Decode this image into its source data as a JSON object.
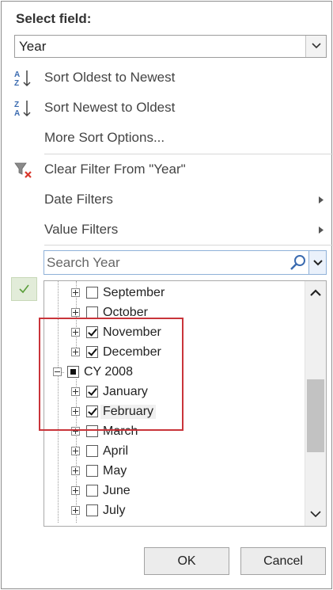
{
  "panel": {
    "title": "Select field:",
    "field_value": "Year"
  },
  "menu": {
    "sort_asc": "Sort Oldest to Newest",
    "sort_desc": "Sort Newest to Oldest",
    "more_sort": "More Sort Options...",
    "clear_filter": "Clear Filter From \"Year\"",
    "date_filters": "Date Filters",
    "value_filters": "Value Filters"
  },
  "search": {
    "placeholder": "Search Year"
  },
  "tree": {
    "items": [
      {
        "label": "September",
        "checked": false
      },
      {
        "label": "October",
        "checked": false
      },
      {
        "label": "November",
        "checked": true
      },
      {
        "label": "December",
        "checked": true
      },
      {
        "label": "CY 2008",
        "checked": "partial"
      },
      {
        "label": "January",
        "checked": true
      },
      {
        "label": "February",
        "checked": true
      },
      {
        "label": "March",
        "checked": false
      },
      {
        "label": "April",
        "checked": false
      },
      {
        "label": "May",
        "checked": false
      },
      {
        "label": "June",
        "checked": false
      },
      {
        "label": "July",
        "checked": false
      }
    ]
  },
  "buttons": {
    "ok": "OK",
    "cancel": "Cancel"
  },
  "colors": {
    "highlight_box": "#c9343a",
    "select_all_check": "#5a9e3a",
    "clear_filter_x": "#d9382c"
  }
}
